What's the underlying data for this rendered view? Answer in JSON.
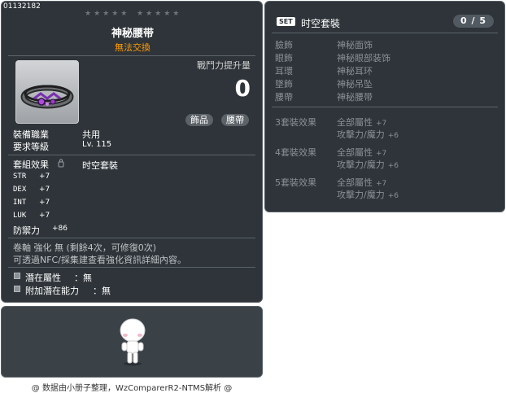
{
  "item": {
    "id": "01132182",
    "name": "神秘腰带",
    "tradable": "無法交換",
    "power_label": "戰鬥力提升量",
    "power_value": "0",
    "tags": [
      "飾品",
      "腰帶"
    ],
    "job_label": "裝備職業",
    "job_value": "共用",
    "level_label": "要求等級",
    "level_value": "Lv. 115",
    "set_label": "套組效果",
    "set_value": "时空套裝",
    "stats": [
      {
        "name": "STR",
        "value": "+7"
      },
      {
        "name": "DEX",
        "value": "+7"
      },
      {
        "name": "INT",
        "value": "+7"
      },
      {
        "name": "LUK",
        "value": "+7"
      }
    ],
    "defense_label": "防禦力",
    "defense_value": "+86",
    "scroll_text": "卷軸 強化 無 (剩餘4次，可修復0次)",
    "npc_text": "可透過NFC/採集建查看強化資訊詳細內容。",
    "potential_label": "潛在屬性",
    "potential_value": "：無",
    "bonus_potential_label": "附加潛在能力",
    "bonus_potential_value": "：無"
  },
  "set": {
    "badge": "SET",
    "title": "时空套裝",
    "count": "0 / 5",
    "pieces": [
      {
        "slot": "臉飾",
        "name": "神秘面饰"
      },
      {
        "slot": "眼飾",
        "name": "神秘眼部装饰"
      },
      {
        "slot": "耳環",
        "name": "神秘耳环"
      },
      {
        "slot": "墜飾",
        "name": "神秘吊坠"
      },
      {
        "slot": "腰帶",
        "name": "神秘腰带"
      }
    ],
    "effects": [
      {
        "label": "3套裝效果",
        "line1": "全部屬性",
        "v1": "+7",
        "line2": "攻擊力/魔力",
        "v2": "+6"
      },
      {
        "label": "4套裝效果",
        "line1": "全部屬性",
        "v1": "+7",
        "line2": "攻擊力/魔力",
        "v2": "+6"
      },
      {
        "label": "5套裝效果",
        "line1": "全部屬性",
        "v1": "+7",
        "line2": "攻擊力/魔力",
        "v2": "+6"
      }
    ]
  },
  "stars": [
    "★★★★★",
    "★★★★★"
  ],
  "footer": "@ 数据由小册子整理，WzComparerR2-NTMS解析 @",
  "colors": {
    "panel": "#2e3439",
    "tradable": "#ff9a00",
    "muted": "#8a9096"
  }
}
